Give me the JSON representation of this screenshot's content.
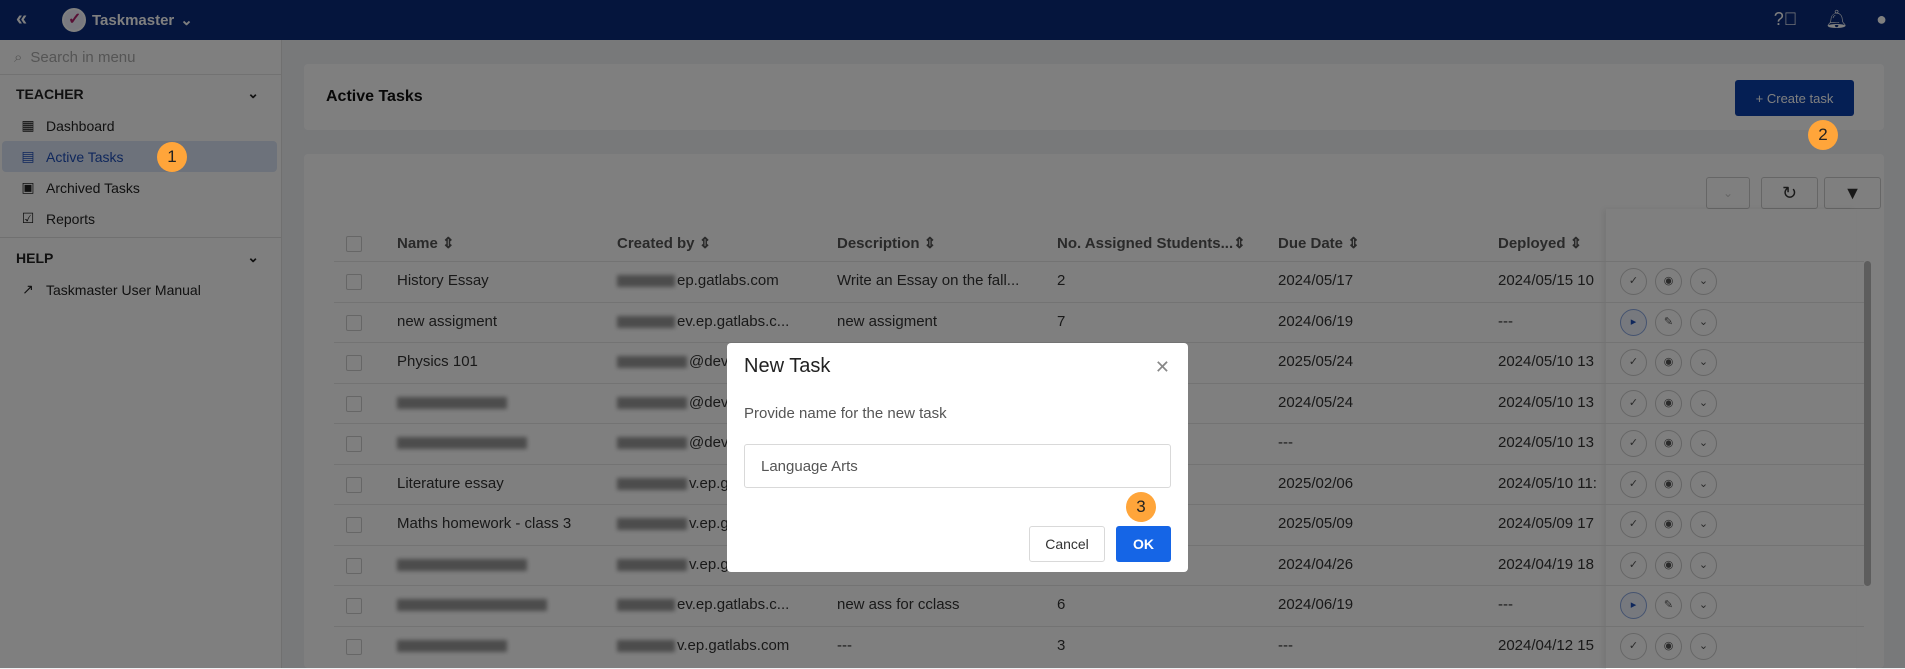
{
  "topbar": {
    "app_name": "Taskmaster"
  },
  "sidebar": {
    "search_placeholder": "Search in menu",
    "sections": [
      {
        "title": "TEACHER",
        "items": [
          {
            "label": "Dashboard",
            "icon": "dashboard-icon"
          },
          {
            "label": "Active Tasks",
            "icon": "document-icon",
            "active": true
          },
          {
            "label": "Archived Tasks",
            "icon": "archive-icon"
          },
          {
            "label": "Reports",
            "icon": "clipboard-check-icon"
          }
        ]
      },
      {
        "title": "HELP",
        "items": [
          {
            "label": "Taskmaster User Manual",
            "icon": "external-link-icon"
          }
        ]
      }
    ]
  },
  "page": {
    "title": "Active Tasks",
    "create_label": "+ Create task"
  },
  "table": {
    "columns": [
      "Name",
      "Created by",
      "Description",
      "No. Assigned Students...",
      "Due Date",
      "Deployed"
    ],
    "rows": [
      {
        "name": "History Essay",
        "created": "ep.gatlabs.com",
        "desc": "Write an Essay on the fall...",
        "count": "2",
        "due": "2024/05/17",
        "deployed": "2024/05/15 10",
        "state": "deployed"
      },
      {
        "name": "new assigment",
        "created": "ev.ep.gatlabs.c...",
        "desc": "new assigment",
        "count": "7",
        "due": "2024/06/19",
        "deployed": "---",
        "state": "draft"
      },
      {
        "name": "Physics 101",
        "created": "@dev.",
        "desc": "",
        "count": "",
        "due": "2025/05/24",
        "deployed": "2024/05/10 13",
        "state": "deployed"
      },
      {
        "name": "",
        "created": "@dev.",
        "desc": "",
        "count": "",
        "due": "2024/05/24",
        "deployed": "2024/05/10 13",
        "state": "deployed"
      },
      {
        "name": "",
        "created": "@dev.",
        "desc": "",
        "count": "",
        "due": "---",
        "deployed": "2024/05/10 13",
        "state": "deployed"
      },
      {
        "name": "Literature essay",
        "created": "v.ep.g",
        "desc": "",
        "count": "",
        "due": "2025/02/06",
        "deployed": "2024/05/10 11:",
        "state": "deployed"
      },
      {
        "name": "Maths homework - class 3",
        "created": "v.ep.g",
        "desc": "",
        "count": "",
        "due": "2025/05/09",
        "deployed": "2024/05/09 17",
        "state": "deployed"
      },
      {
        "name": "",
        "created": "v.ep.g",
        "desc": "",
        "count": "",
        "due": "2024/04/26",
        "deployed": "2024/04/19 18",
        "state": "deployed"
      },
      {
        "name": "",
        "created": "ev.ep.gatlabs.c...",
        "desc": "new ass for cclass",
        "count": "6",
        "due": "2024/06/19",
        "deployed": "---",
        "state": "draft"
      },
      {
        "name": "",
        "created": "v.ep.gatlabs.com",
        "desc": "---",
        "count": "3",
        "due": "---",
        "deployed": "2024/04/12 15",
        "state": "deployed"
      }
    ]
  },
  "modal": {
    "title": "New Task",
    "prompt": "Provide name for the new task",
    "input_value": "Language Arts",
    "cancel": "Cancel",
    "ok": "OK"
  },
  "badges": [
    "1",
    "2",
    "3"
  ],
  "colors": {
    "topbar": "#0a2a7a",
    "primary": "#0b3ea8",
    "ok": "#1565e6",
    "badge": "#ffa53a"
  }
}
